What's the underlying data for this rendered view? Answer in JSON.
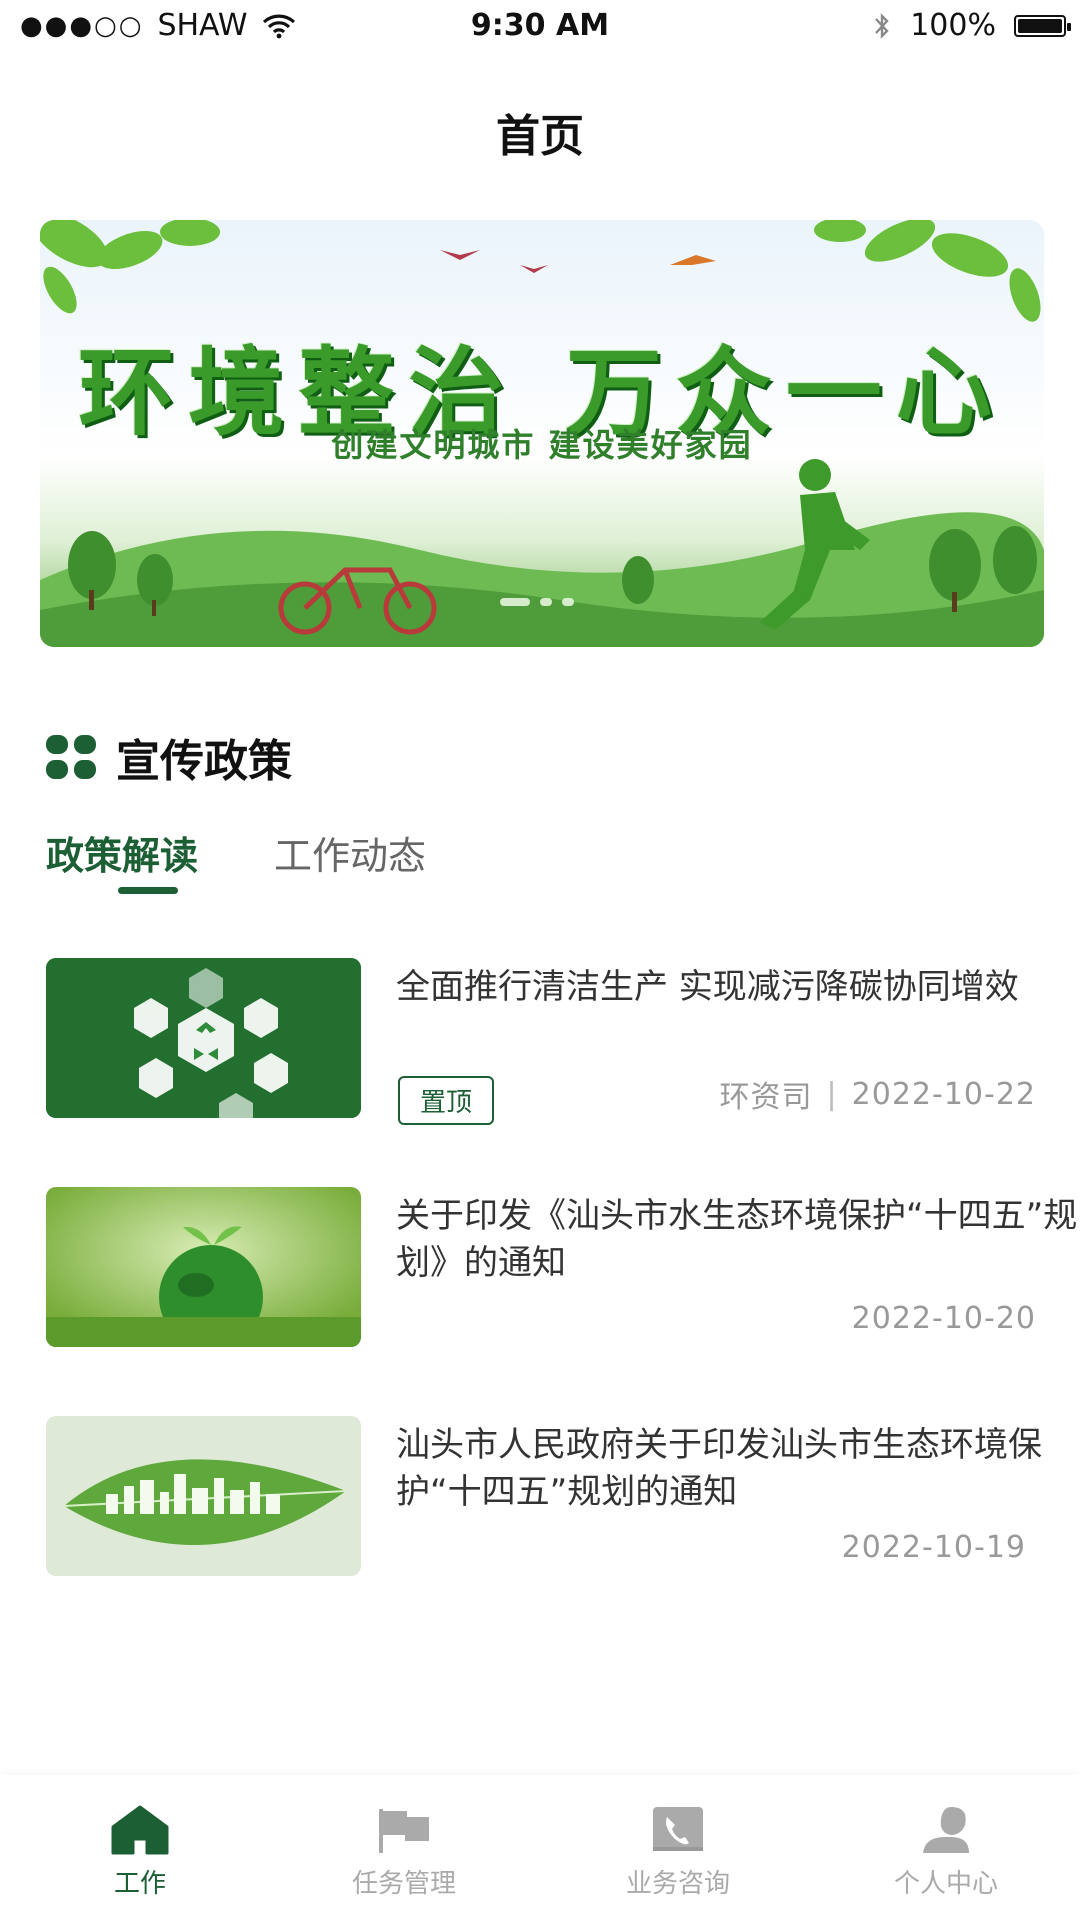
{
  "status_bar": {
    "signal": "●●●○○",
    "carrier": "SHAW",
    "time": "9:30 AM",
    "battery": "100%"
  },
  "header": {
    "title": "首页"
  },
  "banner": {
    "title": "环境整治 万众一心",
    "subtitle": "创建文明城市 建设美好家园"
  },
  "section": {
    "title": "宣传政策"
  },
  "tabs": [
    {
      "label": "政策解读",
      "active": true
    },
    {
      "label": "工作动态",
      "active": false
    }
  ],
  "news": [
    {
      "title": "全面推行清洁生产 实现减污降碳协同增效",
      "badge": "置顶",
      "source": "环资司",
      "separator": "|",
      "date": "2022-10-22",
      "image": "recycle-hexagon-icons"
    },
    {
      "title": "关于印发《汕头市水生态环境保护“十四五”规划》的通知",
      "date": "2022-10-20",
      "image": "green-globe-on-grass"
    },
    {
      "title": "汕头市人民政府关于印发汕头市生态环境保护“十四五”规划的通知",
      "date": "2022-10-19",
      "image": "leaf-city-skyline"
    }
  ],
  "bottom_nav": [
    {
      "label": "工作",
      "icon": "home-icon",
      "active": true
    },
    {
      "label": "任务管理",
      "icon": "flag-icon",
      "active": false
    },
    {
      "label": "业务咨询",
      "icon": "phone-icon",
      "active": false
    },
    {
      "label": "个人中心",
      "icon": "person-icon",
      "active": false
    }
  ],
  "colors": {
    "accent": "#1d5f35",
    "inactive": "#aaaaaa"
  }
}
